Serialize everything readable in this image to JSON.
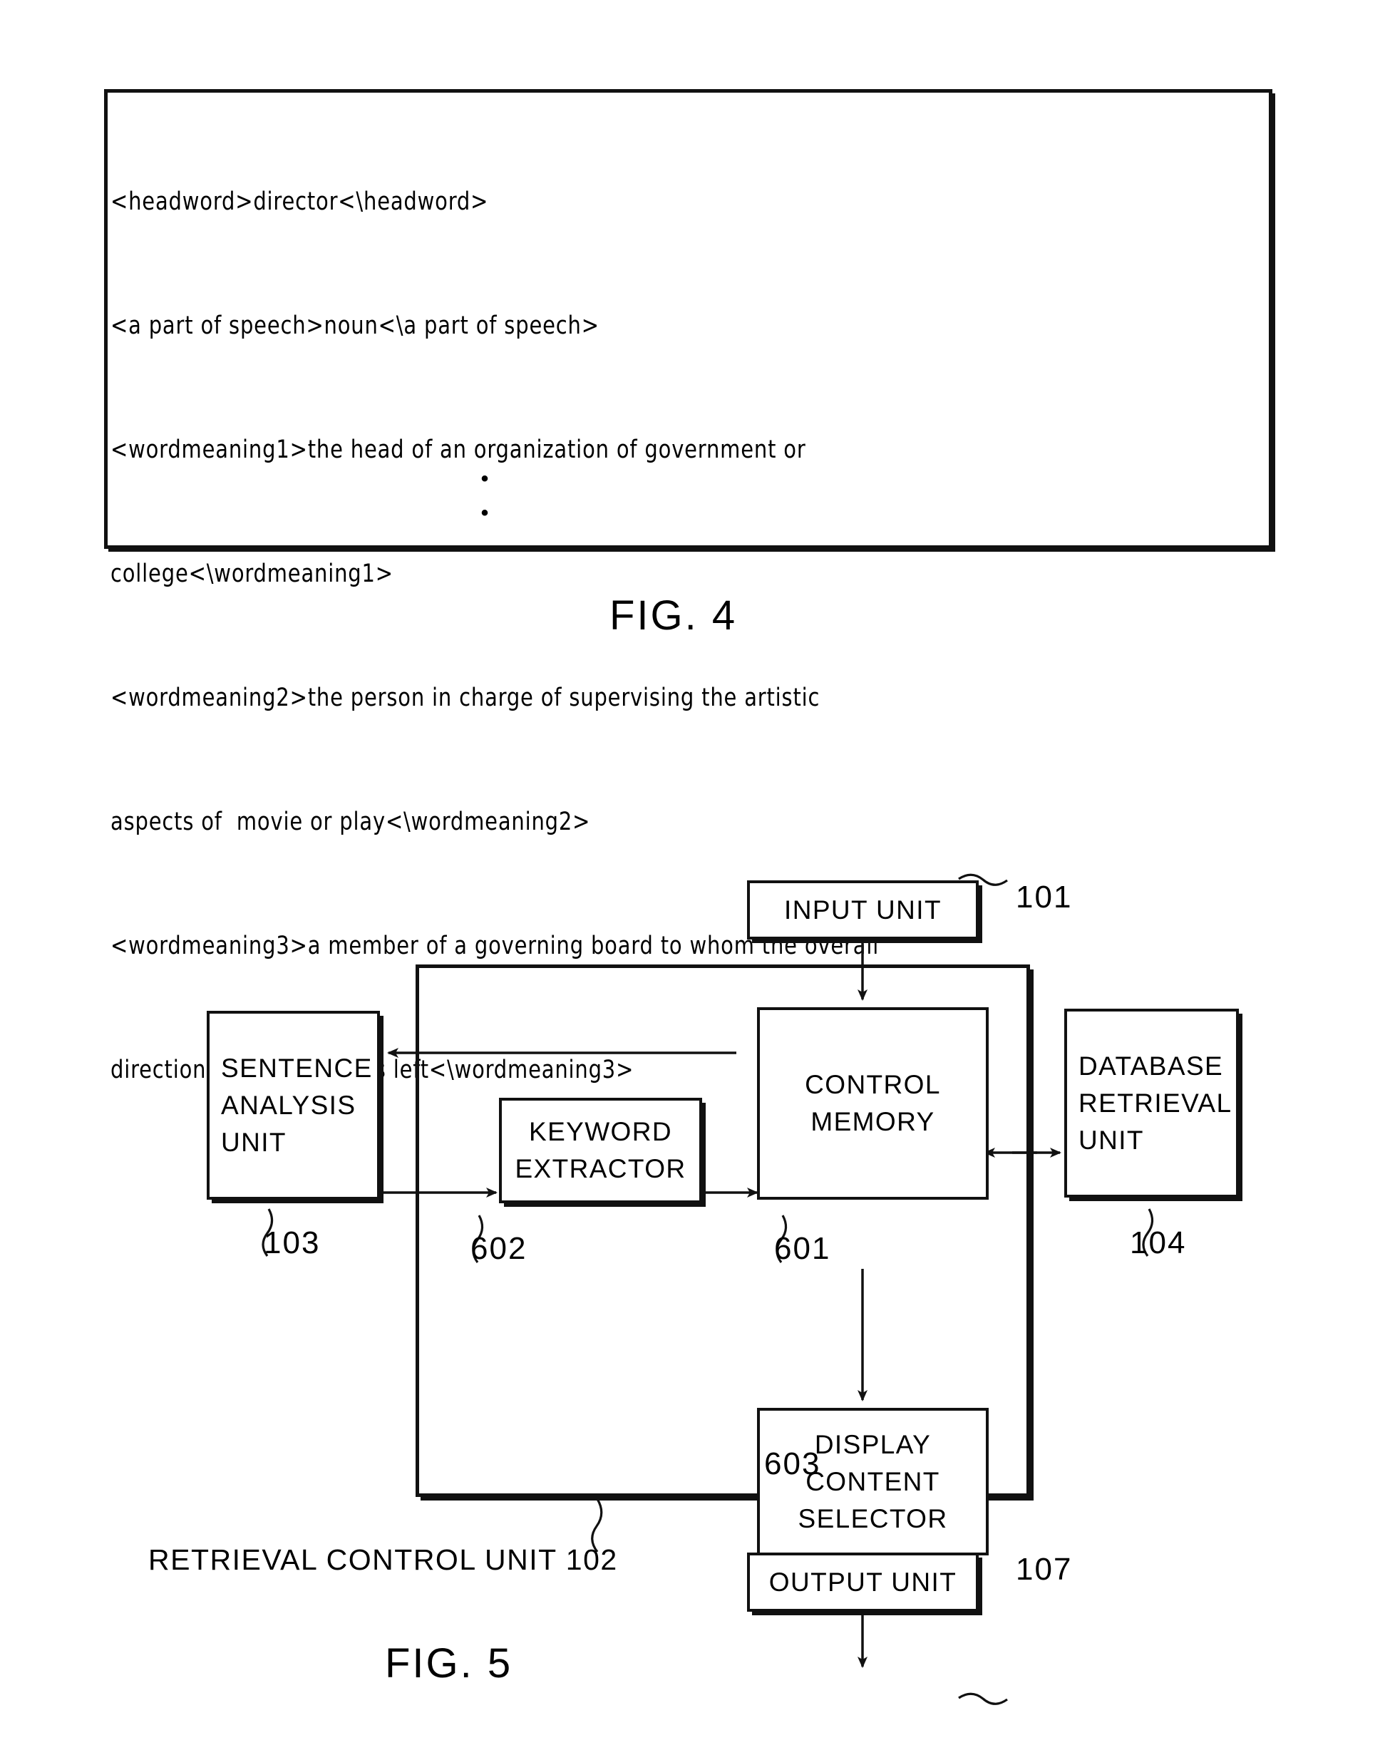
{
  "figure4": {
    "label": "FIG. 4",
    "dictionary_entry_lines": [
      "<headword>director<\\headword>",
      "<a part of speech>noun<\\a part of speech>",
      "<wordmeaning1>the head of an organization of government or",
      "college<\\wordmeaning1>",
      "<wordmeaning2>the person in charge of supervising the artistic",
      "aspects of  movie or play<\\wordmeaning2>",
      "<wordmeaning3>a member of a governing board to whom the overall",
      "direction of a company is left<\\wordmeaning3>"
    ],
    "continuation_dots": [
      "•",
      "•"
    ]
  },
  "figure5": {
    "label": "FIG. 5",
    "outer_block": {
      "caption": "RETRIEVAL CONTROL UNIT 102",
      "ref": "102"
    },
    "nodes": [
      {
        "id": "input",
        "lines": [
          "INPUT UNIT"
        ],
        "ref": "101"
      },
      {
        "id": "sentence",
        "lines": [
          "SENTENCE",
          "ANALYSIS",
          "UNIT"
        ],
        "ref": "103"
      },
      {
        "id": "keyword",
        "lines": [
          "KEYWORD",
          "EXTRACTOR"
        ],
        "ref": "602"
      },
      {
        "id": "control",
        "lines": [
          "CONTROL",
          "MEMORY"
        ],
        "ref": "601"
      },
      {
        "id": "database",
        "lines": [
          "DATABASE",
          "RETRIEVAL",
          "UNIT"
        ],
        "ref": "104"
      },
      {
        "id": "display",
        "lines": [
          "DISPLAY",
          "CONTENT",
          "SELECTOR"
        ],
        "ref": "603"
      },
      {
        "id": "output",
        "lines": [
          "OUTPUT UNIT"
        ],
        "ref": "107"
      }
    ],
    "connections": [
      {
        "from": "input",
        "to": "control",
        "type": "arrow"
      },
      {
        "from": "control",
        "to": "sentence",
        "type": "arrow"
      },
      {
        "from": "sentence",
        "to": "keyword",
        "type": "arrow"
      },
      {
        "from": "keyword",
        "to": "control",
        "type": "arrow"
      },
      {
        "from": "control",
        "to": "database",
        "type": "bidirectional"
      },
      {
        "from": "control",
        "to": "display",
        "type": "arrow"
      },
      {
        "from": "display",
        "to": "output",
        "type": "arrow"
      }
    ]
  },
  "colors": {
    "ink": "#111111",
    "paper": "#ffffff"
  }
}
